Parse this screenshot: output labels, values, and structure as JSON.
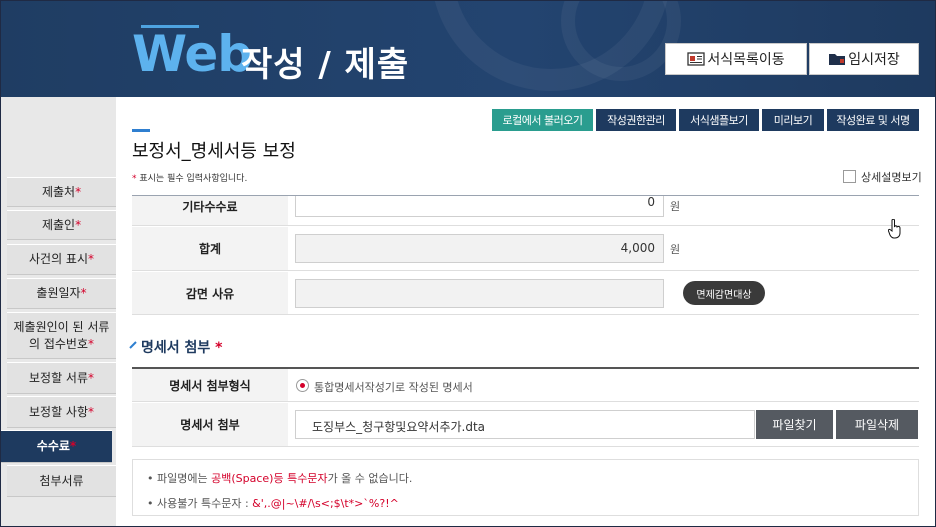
{
  "header": {
    "logo_web": "Web",
    "logo_rest": "작성 / 제출",
    "btn_form_list": "서식목록이동",
    "btn_temp_save": "임시저장",
    "btn_form_list_icon": "form-list-icon",
    "btn_temp_save_icon": "folder-icon"
  },
  "sidebar": {
    "items": [
      {
        "label": "제출처",
        "required": "*"
      },
      {
        "label": "제출인",
        "required": "*"
      },
      {
        "label": "사건의 표시",
        "required": "*"
      },
      {
        "label": "출원일자",
        "required": "*"
      },
      {
        "label": "제출원인이 된 서류 의 접수번호",
        "required": "*"
      },
      {
        "label": "보정할 서류",
        "required": "*"
      },
      {
        "label": "보정할 사항",
        "required": "*"
      },
      {
        "label": "수수료",
        "required": "*"
      },
      {
        "label": "첨부서류",
        "required": ""
      }
    ],
    "active_index": 7
  },
  "toolbar": {
    "load_local": "로컬에서 불러오기",
    "auth_manage": "작성권한관리",
    "sample_view": "서식샘플보기",
    "preview": "미리보기",
    "complete_sign": "작성완료 및 서명"
  },
  "page": {
    "title": "보정서_명세서등 보정",
    "required_mark": "*",
    "required_note": "표시는 필수 입력사항입니다.",
    "detail_view": "상세설명보기"
  },
  "fee": {
    "other_fee_label": "기타수수료",
    "other_fee_value": "0",
    "other_fee_unit": "원",
    "total_label": "합계",
    "total_value": "4,000",
    "total_unit": "원",
    "reduction_label": "감면 사유",
    "reduction_value": "",
    "reduction_button": "면제감면대상"
  },
  "attachment": {
    "section_title": "명세서 첨부",
    "section_required": "*",
    "format_label": "명세서 첨부형식",
    "format_option": "통합명세서작성기로 작성된 명세서",
    "file_label": "명세서 첨부",
    "file_name": "도징부스_청구항및요약서추가.dta",
    "find_file": "파일찾기",
    "delete_file": "파일삭제"
  },
  "notes": {
    "line1_prefix": "파일명에는 ",
    "line1_red": "공백(Space)등 특수문자",
    "line1_suffix": "가 올 수 없습니다.",
    "line2_prefix": "사용불가 특수문자 : ",
    "line2_red": "&',.@|~\\#/\\s<;$\\t*>`%?!^"
  },
  "colors": {
    "navy": "#1e3a5f",
    "accent_blue": "#5db2ee",
    "green_button": "#2a9d8f",
    "required_red": "#d4002a"
  }
}
